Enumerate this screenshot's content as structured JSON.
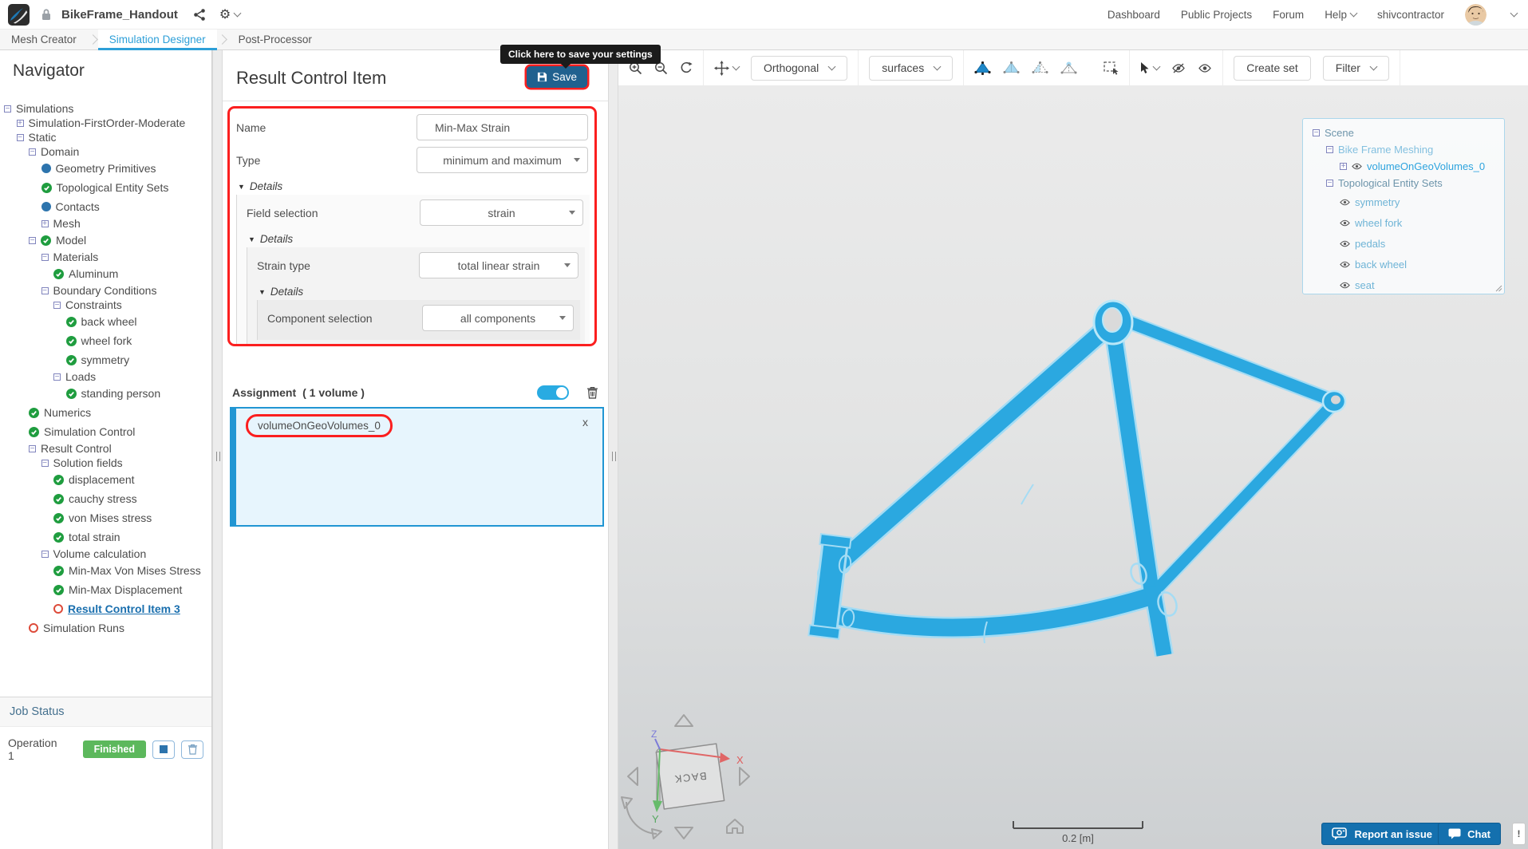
{
  "colors": {
    "accent": "#29abe2",
    "active_tab": "#2d9fd8",
    "save_button": "#20618f",
    "highlight_red": "#fb1f1f",
    "finished_green": "#5cb85c",
    "frame_blue": "#2ba8e0",
    "assignment_border": "#2196d3"
  },
  "icons": {
    "gear": "⚙",
    "details_arrow": "▼",
    "close_x": "x",
    "collapse": "−",
    "expand": "+",
    "alert": "!"
  },
  "header": {
    "title": "BikeFrame_Handout",
    "nav": [
      "Dashboard",
      "Public Projects",
      "Forum",
      "Help",
      "shivcontractor"
    ]
  },
  "tabs": [
    {
      "label": "Mesh Creator",
      "active": false
    },
    {
      "label": "Simulation Designer",
      "active": true
    },
    {
      "label": "Post-Processor",
      "active": false
    }
  ],
  "navigator": {
    "title": "Navigator",
    "tree": [
      {
        "label": "Simulations",
        "lv": 0,
        "exp": "minus"
      },
      {
        "label": "Simulation-FirstOrder-Moderate",
        "lv": 1,
        "exp": "plus"
      },
      {
        "label": "Static",
        "lv": 1,
        "exp": "minus"
      },
      {
        "label": "Domain",
        "lv": 2,
        "exp": "minus"
      },
      {
        "label": "Geometry Primitives",
        "lv": 3,
        "st": "dot"
      },
      {
        "label": "Topological Entity Sets",
        "lv": 3,
        "st": "check"
      },
      {
        "label": "Contacts",
        "lv": 3,
        "st": "dot"
      },
      {
        "label": "Mesh",
        "lv": 3,
        "exp": "plus"
      },
      {
        "label": "Model",
        "lv": 2,
        "exp": "minus",
        "st": "check"
      },
      {
        "label": "Materials",
        "lv": 3,
        "exp": "minus"
      },
      {
        "label": "Aluminum",
        "lv": 4,
        "st": "check"
      },
      {
        "label": "Boundary Conditions",
        "lv": 3,
        "exp": "minus"
      },
      {
        "label": "Constraints",
        "lv": 4,
        "exp": "minus"
      },
      {
        "label": "back wheel",
        "lv": 5,
        "st": "check"
      },
      {
        "label": "wheel fork",
        "lv": 5,
        "st": "check"
      },
      {
        "label": "symmetry",
        "lv": 5,
        "st": "check"
      },
      {
        "label": "Loads",
        "lv": 4,
        "exp": "minus"
      },
      {
        "label": "standing person",
        "lv": 5,
        "st": "check"
      },
      {
        "label": "Numerics",
        "lv": 2,
        "st": "check"
      },
      {
        "label": "Simulation Control",
        "lv": 2,
        "st": "check"
      },
      {
        "label": "Result Control",
        "lv": 2,
        "exp": "minus"
      },
      {
        "label": "Solution fields",
        "lv": 3,
        "exp": "minus"
      },
      {
        "label": "displacement",
        "lv": 4,
        "st": "check"
      },
      {
        "label": "cauchy stress",
        "lv": 4,
        "st": "check"
      },
      {
        "label": "von Mises stress",
        "lv": 4,
        "st": "check"
      },
      {
        "label": "total strain",
        "lv": 4,
        "st": "check"
      },
      {
        "label": "Volume calculation",
        "lv": 3,
        "exp": "minus"
      },
      {
        "label": "Min-Max Von Mises Stress",
        "lv": 4,
        "st": "check"
      },
      {
        "label": "Min-Max Displacement",
        "lv": 4,
        "st": "check"
      },
      {
        "label": "Result Control Item 3",
        "lv": 4,
        "st": "ring",
        "sel": true
      },
      {
        "label": "Simulation Runs",
        "lv": 2,
        "st": "ring"
      }
    ]
  },
  "job_status": {
    "title": "Job Status",
    "operation": "Operation 1",
    "badge": "Finished"
  },
  "panel": {
    "title": "Result Control Item",
    "save_label": "Save",
    "tooltip": "Click here to save your settings",
    "name_label": "Name",
    "name_value": "Min-Max Strain",
    "type_label": "Type",
    "type_value": "minimum and maximum",
    "details_label": "Details",
    "field_selection_label": "Field selection",
    "field_selection_value": "strain",
    "strain_type_label": "Strain type",
    "strain_type_value": "total linear strain",
    "component_label": "Component selection",
    "component_value": "all components",
    "assignment_label": "Assignment",
    "assignment_count": "( 1 volume )",
    "assignment_item": "volumeOnGeoVolumes_0"
  },
  "viewport": {
    "orthogonal": "Orthogonal",
    "surfaces": "surfaces",
    "create_set": "Create set",
    "filter": "Filter",
    "scene": [
      {
        "label": "Scene",
        "lv": 0,
        "exp": "minus",
        "cls": "root"
      },
      {
        "label": "Bike Frame Meshing",
        "lv": 1,
        "exp": "minus",
        "cls": "mesh"
      },
      {
        "label": "volumeOnGeoVolumes_0",
        "lv": 2,
        "exp": "plus",
        "eye": true,
        "cls": "selitem"
      },
      {
        "label": "Topological Entity Sets",
        "lv": 1,
        "exp": "minus",
        "cls": "parent"
      },
      {
        "label": "symmetry",
        "lv": 2,
        "eye": true,
        "cls": "leaf"
      },
      {
        "label": "wheel fork",
        "lv": 2,
        "eye": true,
        "cls": "leaf"
      },
      {
        "label": "pedals",
        "lv": 2,
        "eye": true,
        "cls": "leaf"
      },
      {
        "label": "back wheel",
        "lv": 2,
        "eye": true,
        "cls": "leaf"
      },
      {
        "label": "seat",
        "lv": 2,
        "eye": true,
        "cls": "leaf"
      }
    ],
    "scale_label": "0.2 [m]",
    "cube_label": "BACK",
    "axis_x": "X",
    "axis_y": "Y",
    "axis_z": "Z",
    "report_button": "Report an issue",
    "chat_button": "Chat"
  }
}
